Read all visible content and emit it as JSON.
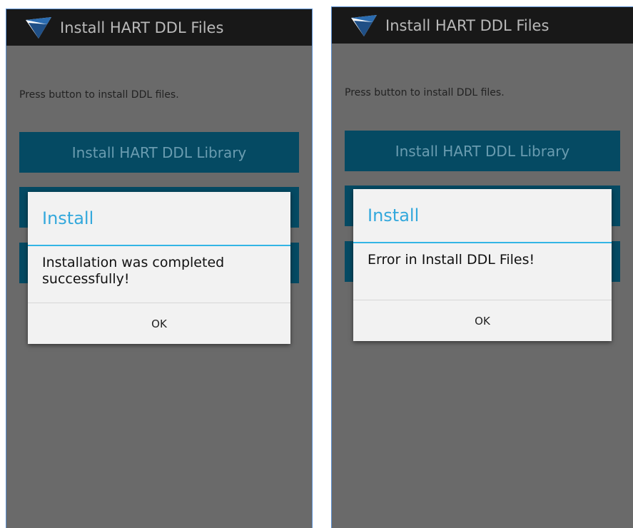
{
  "screens": [
    {
      "app_title": "Install HART DDL Files",
      "hint_text": "Press button to install DDL files.",
      "library_button_label": "Install HART DDL Library",
      "dialog": {
        "title": "Install",
        "message": "Installation was completed successfully!",
        "ok_label": "OK"
      }
    },
    {
      "app_title": "Install HART DDL Files",
      "hint_text": "Press button to install DDL files.",
      "library_button_label": "Install HART DDL Library",
      "dialog": {
        "title": "Install",
        "message": "Error in Install DDL Files!",
        "ok_label": "OK"
      }
    }
  ],
  "icons": {
    "app_logo": "app-logo-icon"
  },
  "colors": {
    "action_bar": "#181818",
    "dim_background": "#6a6a6a",
    "button_fill": "#054a63",
    "dialog_accent": "#33b5e5",
    "dialog_bg": "#f2f2f2"
  }
}
